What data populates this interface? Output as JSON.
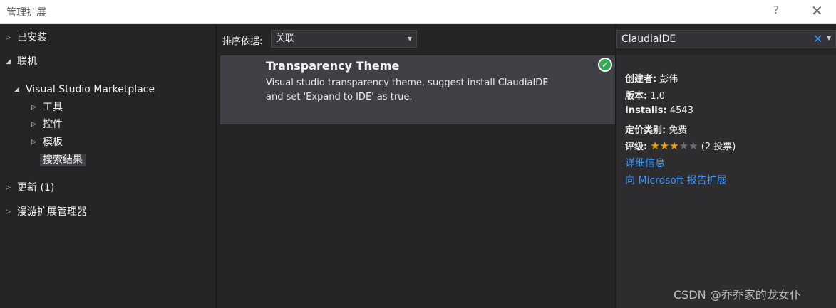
{
  "window": {
    "title": "管理扩展",
    "help_glyph": "?",
    "close_glyph": "✕"
  },
  "tree": {
    "installed": "已安装",
    "online": "联机",
    "marketplace": "Visual Studio Marketplace",
    "tools": "工具",
    "controls": "控件",
    "templates": "模板",
    "search_results": "搜索结果",
    "updates": "更新 (1)",
    "roaming": "漫游扩展管理器"
  },
  "sort": {
    "label": "排序依据:",
    "value": "关联"
  },
  "extension": {
    "title": "Transparency Theme",
    "description_line1": "Visual studio transparency theme, suggest install ClaudiaIDE",
    "description_line2": "and set 'Expand to IDE' as true.",
    "installed_check": "✓"
  },
  "search": {
    "value": "ClaudiaIDE",
    "clear_glyph": "✕"
  },
  "details": {
    "creator_label": "创建者:",
    "creator": "彭伟",
    "version_label": "版本:",
    "version": "1.0",
    "installs_label": "Installs:",
    "installs": "4543",
    "pricing_label": "定价类别:",
    "pricing": "免费",
    "rating_label": "评级:",
    "rating_votes": "(2 投票)",
    "rating_value": 3,
    "rating_max": 5,
    "more_info_link": "详细信息",
    "report_link": "向 Microsoft 报告扩展"
  },
  "watermark": "CSDN @乔乔家的龙女仆",
  "colors": {
    "accent": "#3794ff",
    "star": "#f0a30a",
    "check": "#35a853"
  },
  "icons": {
    "collapsed": "chevron-right-icon",
    "expanded": "chevron-down-icon",
    "dropdown": "dropdown-arrow-icon",
    "check": "check-circle-icon"
  }
}
